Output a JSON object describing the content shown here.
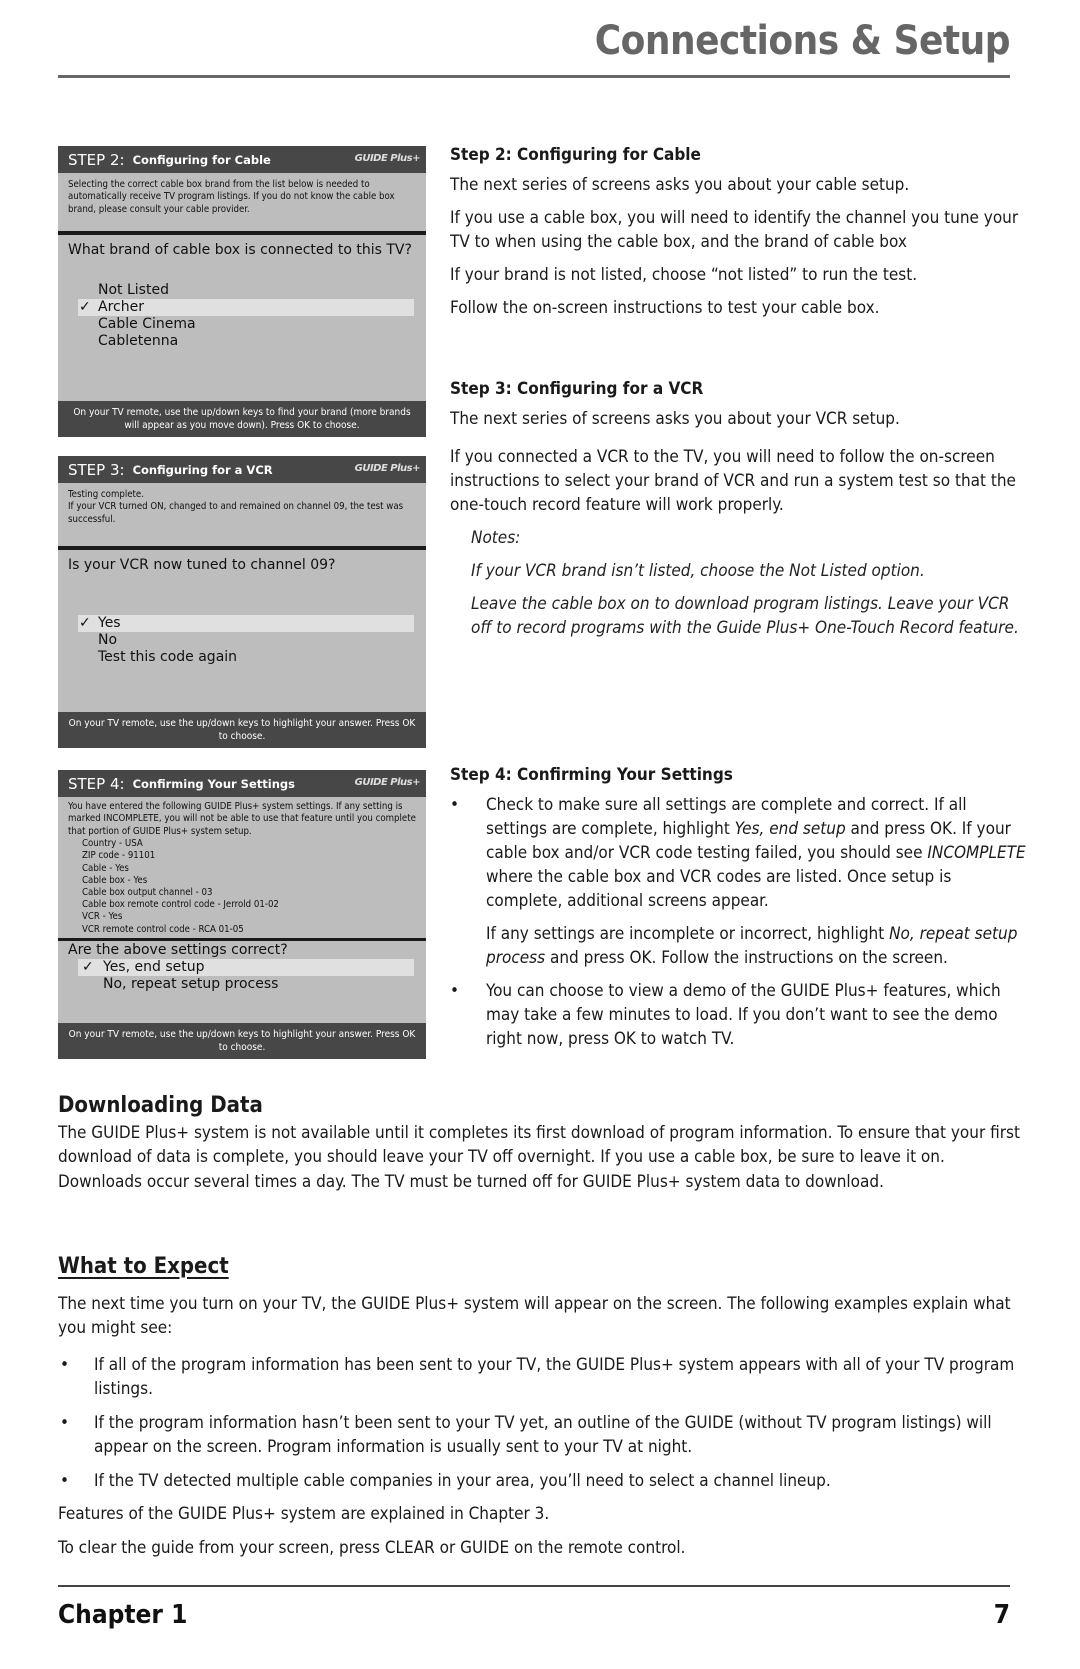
{
  "header": {
    "title": "Connections & Setup"
  },
  "panels": {
    "step2": {
      "step": "STEP 2:",
      "title": "Configuring for Cable",
      "logo": "GUIDE Plus+",
      "intro": "Selecting the correct cable box brand from the list below is needed to automatically receive TV program listings.  If you do not know the cable box brand, please consult your cable provider.",
      "question": "What brand of cable box is connected to this TV?",
      "options": [
        {
          "label": "Not Listed",
          "selected": false
        },
        {
          "label": "Archer",
          "selected": true
        },
        {
          "label": "Cable Cinema",
          "selected": false
        },
        {
          "label": "Cabletenna",
          "selected": false
        }
      ],
      "check": "✓",
      "footer": "On your TV remote, use the up/down keys to find your brand (more brands will appear as you move down).  Press OK to choose."
    },
    "step3": {
      "step": "STEP 3:",
      "title": "Configuring for a VCR",
      "logo": "GUIDE Plus+",
      "intro_lines": [
        "Testing complete.",
        "If your VCR turned ON, changed to and remained on channel 09, the test was successful."
      ],
      "question": "Is your VCR now tuned to channel 09?",
      "options": [
        {
          "label": "Yes",
          "selected": true
        },
        {
          "label": "No",
          "selected": false
        },
        {
          "label": "Test this code again",
          "selected": false
        }
      ],
      "check": "✓",
      "footer": "On your TV remote, use the up/down keys to highlight your answer. Press OK to choose."
    },
    "step4": {
      "step": "STEP 4:",
      "title": "Confirming Your Settings",
      "logo": "GUIDE Plus+",
      "intro": "You have entered the following GUIDE Plus+ system settings.  If any setting is marked INCOMPLETE, you will not be able to use that feature until you complete that portion of GUIDE Plus+ system setup.",
      "settings": [
        "Country - USA",
        "ZIP code - 91101",
        "Cable - Yes",
        "Cable box - Yes",
        "Cable box output channel - 03",
        "Cable box remote control code - Jerrold 01-02",
        "VCR - Yes",
        "VCR remote control code - RCA 01-05"
      ],
      "question": "Are the above settings correct?",
      "options": [
        {
          "label": "Yes, end setup",
          "selected": true
        },
        {
          "label": "No, repeat setup process",
          "selected": false
        }
      ],
      "check": "✓",
      "footer": "On your TV remote, use the up/down keys to highlight your answer. Press OK to choose."
    }
  },
  "right": {
    "step2": {
      "heading": "Step 2: Configuring for Cable",
      "paras": [
        "The next series of screens asks you about your cable setup.",
        "If you use a cable box, you will need to identify the channel you tune your TV to when using the cable box, and the brand of cable box",
        "If your brand is not listed, choose “not listed” to run the test.",
        "Follow the on-screen instructions to test your cable box."
      ]
    },
    "step3": {
      "heading": "Step 3: Configuring for a VCR",
      "paras": [
        "The next series of screens asks you about your VCR setup.",
        "If you connected a VCR to the TV, you will need to follow the on-screen instructions to select your brand of VCR and run a system test so that the one-touch record feature will work properly."
      ],
      "notes_label": "Notes:",
      "notes": [
        "If your VCR brand isn’t listed, choose the Not Listed option.",
        "Leave the cable box on to download program listings. Leave your VCR off to record programs with the Guide Plus+ One-Touch Record feature."
      ]
    },
    "step4": {
      "heading": "Step 4: Confirming Your Settings",
      "bullet1": {
        "a": "Check to make sure all settings are complete and correct. If all settings are complete, highlight ",
        "b": "Yes, end setup",
        "c": " and press OK. If your cable box and/or VCR code testing failed, you should see ",
        "d": "INCOMPLETE",
        "e": " where the cable box and VCR codes are listed. Once setup is complete, additional screens appear."
      },
      "sub": {
        "a": "If any settings are incomplete or incorrect, highlight ",
        "b": "No, repeat setup process",
        "c": " and press OK. Follow the instructions on the screen."
      },
      "bullet2": "You can choose to view a demo of the GUIDE Plus+ features, which may take a few minutes to load. If you don’t want to see the demo right now, press OK to watch TV."
    }
  },
  "downloading": {
    "heading": "Downloading Data",
    "text": "The GUIDE Plus+ system is not available until it completes its first download of program information. To ensure that your first download of data is complete, you should leave your TV off overnight. If you use a cable box, be sure to leave it on. Downloads occur several times a day. The TV must be turned off for GUIDE Plus+ system data to download."
  },
  "expect": {
    "heading": "What to Expect",
    "intro": "The next time you turn on your TV, the GUIDE Plus+ system will appear on the screen. The following examples explain what you might see:",
    "bullets": [
      "If all of the program information has been sent to your TV, the GUIDE Plus+ system appears with all of your TV program listings.",
      "If the program information hasn’t been sent to your TV yet, an outline of the GUIDE (without TV program listings) will appear on the screen. Program information is usually sent to your TV at night.",
      "If the TV detected multiple cable companies in your area, you’ll need to select a channel lineup."
    ],
    "features": "Features of the GUIDE Plus+ system are explained in Chapter 3.",
    "clear": "To clear the guide from your screen, press CLEAR or GUIDE on the remote control."
  },
  "footer": {
    "chapter": "Chapter 1",
    "page": "7"
  },
  "bullet_glyph": "•"
}
